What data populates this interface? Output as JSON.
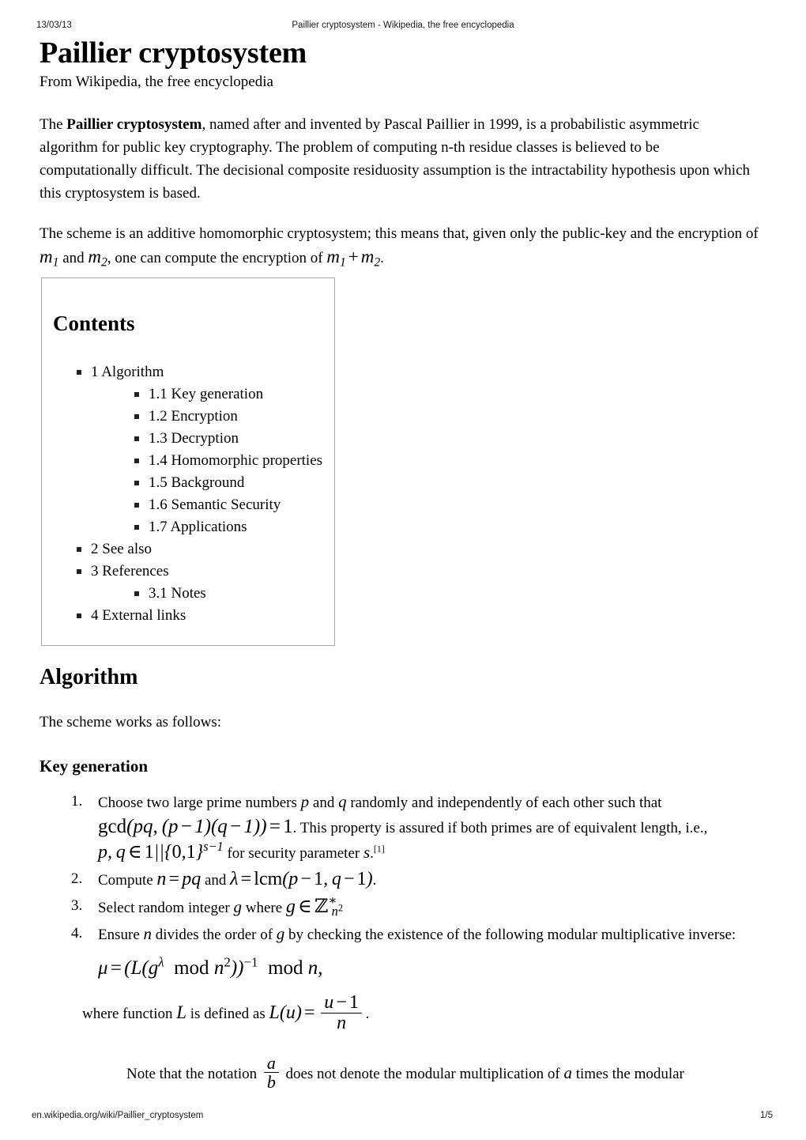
{
  "print_header": {
    "date": "13/03/13",
    "title": "Paillier cryptosystem - Wikipedia, the free encyclopedia"
  },
  "print_footer": {
    "url": "en.wikipedia.org/wiki/Paillier_cryptosystem",
    "page": "1/5"
  },
  "article": {
    "title": "Paillier cryptosystem",
    "tagline": "From Wikipedia, the free encyclopedia",
    "intro": {
      "p1_before_bold": "The ",
      "p1_bold": "Paillier cryptosystem",
      "p1_after_bold": ", named after and invented by Pascal Paillier in 1999, is a probabilistic asymmetric algorithm for public key cryptography. The problem of computing n-th residue classes is believed to be computationally difficult. The decisional composite residuosity assumption is the intractability hypothesis upon which this cryptosystem is based.",
      "p2_part1": "The scheme is an additive homomorphic cryptosystem; this means that, given only the public-key and the encryption of",
      "p2_math1": "m1",
      "p2_part2": "and",
      "p2_math2": "m2",
      "p2_part3": ", one can compute the encryption of",
      "p2_math3": "m1 + m2",
      "p2_part4": "."
    }
  },
  "toc": {
    "title": "Contents",
    "items": [
      {
        "label": "1 Algorithm",
        "children": [
          {
            "label": "1.1 Key generation"
          },
          {
            "label": "1.2 Encryption"
          },
          {
            "label": "1.3 Decryption"
          },
          {
            "label": "1.4 Homomorphic properties"
          },
          {
            "label": "1.5 Background"
          },
          {
            "label": "1.6 Semantic Security"
          },
          {
            "label": "1.7 Applications"
          }
        ]
      },
      {
        "label": "2 See also",
        "children": []
      },
      {
        "label": "3 References",
        "children": [
          {
            "label": "3.1 Notes"
          }
        ]
      },
      {
        "label": "4 External links",
        "children": []
      }
    ]
  },
  "algorithm": {
    "heading": "Algorithm",
    "lead": "The scheme works as follows:",
    "keygen_heading": "Key generation",
    "steps": [
      {
        "text_a": "Choose two large prime numbers",
        "math_p": "p",
        "text_b": "and",
        "math_q": "q",
        "text_c": "randomly and independently of each other such that",
        "math_gcd": "gcd(pq, (p − 1)(q − 1)) = 1",
        "text_d": ". This property is assured if both primes are of equivalent length, i.e.,",
        "math_members": "p, q ∈ 1||{0,1}^(s−1)",
        "text_e": "for security parameter",
        "math_s": "s",
        "text_f": ".",
        "ref": "[1]"
      },
      {
        "text_a": "Compute",
        "math_n": "n = pq",
        "text_b": "and",
        "math_lambda": "λ = lcm(p − 1, q − 1)",
        "text_c": "."
      },
      {
        "text_a": "Select random integer",
        "math_g": "g",
        "text_b": "where",
        "math_gset": "g ∈ Z*_{n²}"
      },
      {
        "text_a": "Ensure",
        "math_n": "n",
        "text_b": "divides the order of",
        "math_g": "g",
        "text_c": "by checking the existence of the following modular multiplicative inverse:",
        "math_mu": "μ = (L(g^λ mod n²))^(−1) mod n,",
        "cont_a": "where function",
        "math_L": "L",
        "cont_b": "is defined as",
        "math_Ldef": "L(u) = (u − 1) / n",
        "cont_c": ".",
        "note_a": "Note that the notation",
        "math_frac": "a / b",
        "note_b": "does not denote the modular multiplication of",
        "math_a": "a",
        "note_c": "times the modular"
      }
    ]
  }
}
